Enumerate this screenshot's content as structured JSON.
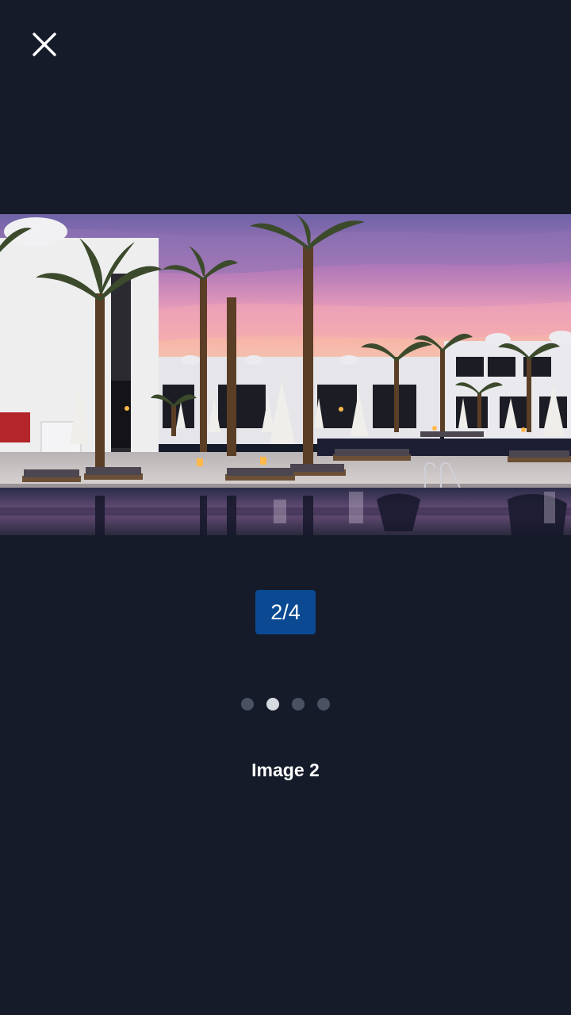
{
  "viewer": {
    "close_icon": "close-icon",
    "counter": "2/4",
    "caption": "Image 2",
    "current_index": 2,
    "total": 4
  },
  "pagination": {
    "dots": [
      {
        "active": false
      },
      {
        "active": true
      },
      {
        "active": false
      },
      {
        "active": false
      }
    ]
  },
  "colors": {
    "background": "#151b28",
    "counter_badge": "#0b4a92",
    "dot_active": "#d7dae0",
    "dot_inactive": "#4a5160"
  }
}
